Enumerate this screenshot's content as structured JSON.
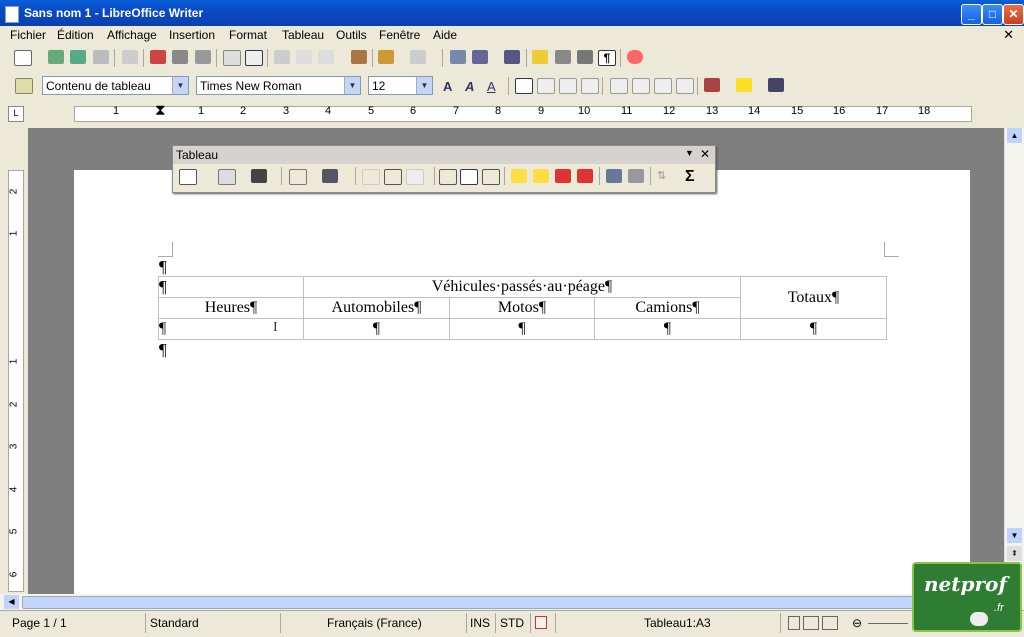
{
  "window": {
    "title": "Sans nom 1 - LibreOffice Writer"
  },
  "menubar": [
    "Fichier",
    "Édition",
    "Affichage",
    "Insertion",
    "Format",
    "Tableau",
    "Outils",
    "Fenêtre",
    "Aide"
  ],
  "formatting": {
    "style": "Contenu de tableau",
    "font": "Times New Roman",
    "size": "12"
  },
  "ruler": {
    "h_marks": [
      "1",
      "1",
      "2",
      "3",
      "4",
      "5",
      "6",
      "7",
      "8",
      "9",
      "10",
      "11",
      "12",
      "13",
      "14",
      "15",
      "16",
      "17",
      "18"
    ],
    "v_marks": [
      "2",
      "1",
      "1",
      "2",
      "3",
      "4",
      "5",
      "6"
    ]
  },
  "table_toolbar": {
    "title": "Tableau"
  },
  "document": {
    "pilcrow": "¶",
    "table": {
      "group_header": "Véhicules·passés·au·péage¶",
      "heures": "Heures¶",
      "totaux": "Totaux¶",
      "sub_headers": [
        "Automobiles¶",
        "Motos¶",
        "Camions¶"
      ],
      "row": [
        "¶",
        "¶",
        "¶",
        "¶",
        "¶"
      ]
    }
  },
  "statusbar": {
    "page": "Page 1 / 1",
    "style": "Standard",
    "language": "Français (France)",
    "ins": "INS",
    "std": "STD",
    "cell": "Tableau1:A3"
  },
  "logo": {
    "text": "netprof",
    "suffix": ".fr"
  },
  "colors": {
    "titlebar": "#0a4ac4",
    "workspace": "#7f7f7f",
    "page": "#ffffff",
    "logo": "#2e7d32"
  }
}
